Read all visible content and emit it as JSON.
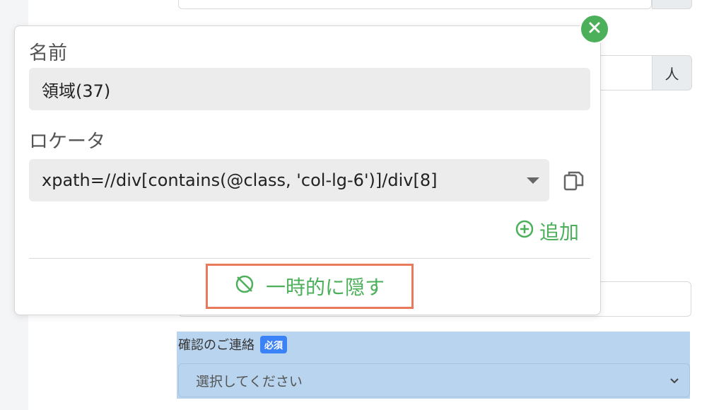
{
  "background": {
    "unit_addon": "人",
    "confirmation_label": "確認のご連絡",
    "required_badge": "必須",
    "select_placeholder": "選択してください"
  },
  "popup": {
    "name_label": "名前",
    "name_value": "領域(37)",
    "locator_label": "ロケータ",
    "locator_value": "xpath=//div[contains(@class, 'col-lg-6')]/div[8]",
    "add_label": "追加",
    "hide_label": "一時的に隠す"
  },
  "icons": {
    "close": "close-icon",
    "copy": "copy-icon",
    "add": "plus-circle-icon",
    "hide": "hide-slash-icon",
    "chevron": "chevron-down-icon"
  },
  "colors": {
    "accent_green": "#4caf5a",
    "highlight_outline": "#e8795a",
    "field_highlight": "#b9d4ee",
    "badge_blue": "#3b82f6"
  }
}
